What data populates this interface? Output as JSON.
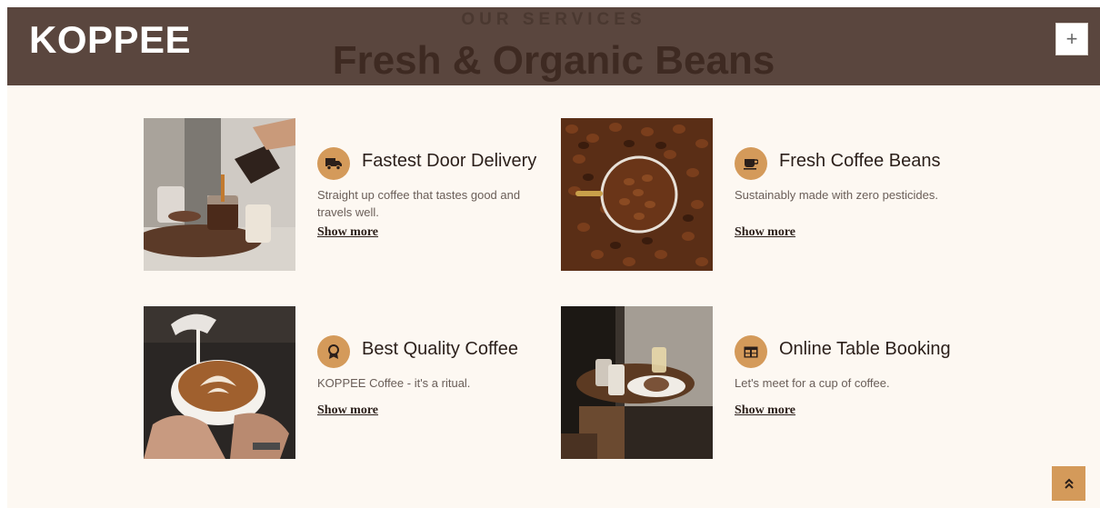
{
  "header": {
    "brand": "KOPPEE",
    "toggle_symbol": "+"
  },
  "section": {
    "eyebrow": "OUR SERVICES",
    "title": "Fresh & Organic Beans"
  },
  "services": [
    {
      "title": "Fastest Door Delivery",
      "description": "Straight up coffee that tastes good and travels well.",
      "link": "Show more",
      "icon": "truck-icon"
    },
    {
      "title": "Fresh Coffee Beans",
      "description": "Sustainably made with zero pesticides.",
      "link": "Show more",
      "icon": "coffee-cup-icon"
    },
    {
      "title": "Best Quality Coffee",
      "description": "KOPPEE Coffee - it's a ritual.",
      "link": "Show more",
      "icon": "award-icon"
    },
    {
      "title": "Online Table Booking",
      "description": "Let's meet for a cup of coffee.",
      "link": "Show more",
      "icon": "table-icon"
    }
  ],
  "colors": {
    "header_bg": "#5a463e",
    "page_bg": "#fdf8f2",
    "accent": "#d49a5a"
  },
  "back_to_top": "double-chevron-up-icon"
}
